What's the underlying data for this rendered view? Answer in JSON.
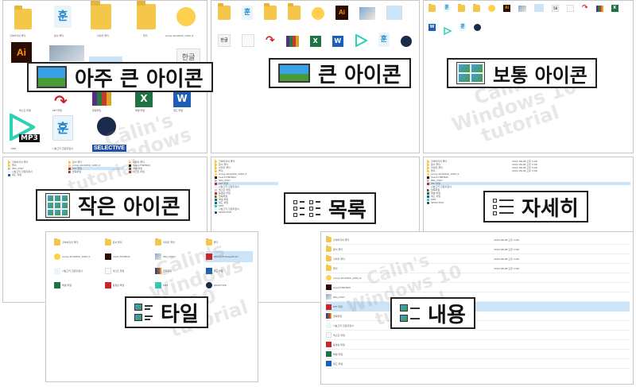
{
  "views": {
    "extra_large": "아주 큰 아이콘",
    "large": "큰 아이콘",
    "medium": "보통 아이콘",
    "small": "작은 아이콘",
    "list": "목록",
    "details": "자세히",
    "tiles": "타일",
    "content": "내용"
  },
  "files": {
    "folder_ohmyscript": "할아버지의 폴더",
    "folder_docs": "문서 폴더",
    "folder_images": "이미지 폴더",
    "folder": "폴더",
    "emoji": "emoji-4016959_1280_6",
    "ai_file": "heart-FINTBOX",
    "hwp": "나눔고딕 한글지침서",
    "file_txt": "텍스트 파일",
    "ppt": "PPT 파일",
    "ppt_desc": "Microsoft PowerPoint",
    "rar": "압축파일",
    "excel": "엑셀 파일",
    "word": "워드 파일",
    "img": "IMG_0567",
    "mp3": "MP3",
    "selective": "SELECTIVE",
    "movie": "동영상 파일"
  },
  "icon_text": {
    "ai": "Ai",
    "hun": "훈",
    "word": "W",
    "excel": "X",
    "hangul": "한글",
    "hwp_short": "58",
    "hwp_mark": "H",
    "red_arrow": "↷",
    "arrow": "↷",
    "mp3": "MP3"
  },
  "details_row": {
    "date": "2022-08-08 오후 3:08",
    "type": "파일 폴더"
  },
  "watermark": {
    "line1": "Cālin's",
    "line2": "Windows 10",
    "line3": "tutorial"
  },
  "colors": {
    "folder": "#f4c74a",
    "selection": "#cce4f7",
    "callout_border": "#222222"
  }
}
